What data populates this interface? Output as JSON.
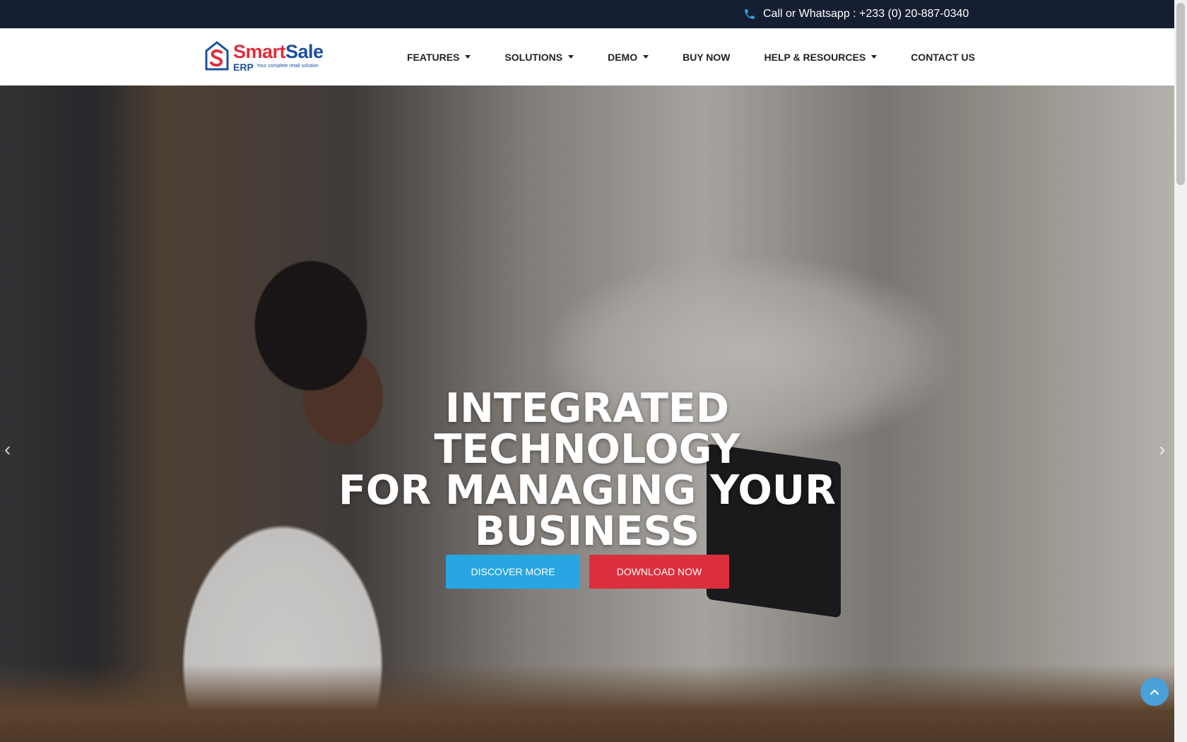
{
  "topbar": {
    "phone_icon": "phone-icon",
    "contact_text": "Call or Whatsapp : +233 (0) 20-887-0340"
  },
  "logo": {
    "name_part1": "Smart",
    "name_part2": "Sale",
    "erp": "ERP",
    "tagline": "Your complete retail solution"
  },
  "nav": {
    "items": [
      {
        "label": "FEATURES",
        "dropdown": true
      },
      {
        "label": "SOLUTIONS",
        "dropdown": true
      },
      {
        "label": "DEMO",
        "dropdown": true
      },
      {
        "label": "BUY NOW",
        "dropdown": false
      },
      {
        "label": "HELP & RESOURCES",
        "dropdown": true
      },
      {
        "label": "CONTACT US",
        "dropdown": false
      }
    ]
  },
  "hero": {
    "title_line1": "INTEGRATED TECHNOLOGY",
    "title_line2": "FOR MANAGING YOUR",
    "title_line3": "BUSINESS",
    "discover_label": "DISCOVER MORE",
    "download_label": "DOWNLOAD NOW",
    "prev_icon": "chevron-left-icon",
    "next_icon": "chevron-right-icon",
    "scroll_top_icon": "chevron-up-icon"
  },
  "colors": {
    "topbar_bg": "#161f32",
    "brand_red": "#e02d3c",
    "brand_blue": "#1c4f9c",
    "discover_bg": "#27a6e1",
    "download_bg": "#dc2f3e",
    "phone_icon": "#2aa7e0"
  }
}
